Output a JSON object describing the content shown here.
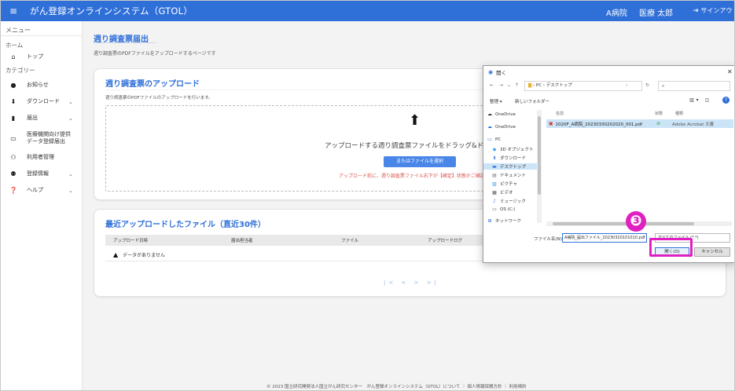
{
  "header": {
    "menu_icon": "hamburger-icon",
    "title": "がん登録オンラインシステム（GTOL）",
    "hospital": "A病院",
    "user": "医療 太郎",
    "signout_icon": "signout-icon",
    "signout_label": "サインアウト"
  },
  "sidebar": {
    "menu_heading": "メニュー",
    "home_heading": "ホーム",
    "category_heading": "カテゴリー",
    "items": [
      {
        "label": "トップ",
        "icon": "home-icon",
        "glyph": "🏠"
      },
      {
        "label": "お知らせ",
        "icon": "info-icon",
        "glyph": "ℹ"
      },
      {
        "label": "ダウンロード",
        "icon": "download-icon",
        "glyph": "⬇"
      },
      {
        "label": "届出",
        "icon": "document-icon",
        "glyph": "▮"
      },
      {
        "label": "医療機関向け提供データ登録届出",
        "icon": "monitor-icon",
        "glyph": "▭"
      },
      {
        "label": "利用者管理",
        "icon": "users-icon",
        "glyph": "👥"
      },
      {
        "label": "登録情報",
        "icon": "user-settings-icon",
        "glyph": "👤"
      },
      {
        "label": "ヘルプ",
        "icon": "help-icon",
        "glyph": "?"
      }
    ]
  },
  "main": {
    "title": "週り調査票届出",
    "description": "週り調査票のPDFファイルをアップロードするページです",
    "upload_card": {
      "title": "週り調査票のアップロード",
      "description": "週り調査票のPDFファイルのアップロードを行います。",
      "drop_text": "アップロードする週り調査票ファイルをドラッグ&ドロップし",
      "select_button": "またはファイルを選択",
      "warning": "アップロード前に、週り調査票ファイル右下が【確定】状態かご確認くだ"
    },
    "recent_card": {
      "title": "最近アップロードしたファイル（直近30件）",
      "columns": [
        "アップロード日時",
        "届出担当者",
        "ファイル",
        "アップロードログ"
      ],
      "empty_text": "データがありません",
      "pager": "|< < > >|"
    },
    "footer": "© 2023 国立研究開発法人国立がん研究センター　がん登録オンラインシステム（GTOL）について ｜ 個人情報保護方針 ｜ 利用規約"
  },
  "dialog": {
    "title": "開く",
    "path": "› PC › デスクトップ",
    "search_placeholder": "",
    "toolbar": {
      "organize": "整理 ▾",
      "new_folder": "新しいフォルダー"
    },
    "nav_items": [
      {
        "label": "OneDrive",
        "icon": "onedrive-icon",
        "glyph": "☁"
      },
      {
        "label": "OneDrive",
        "icon": "onedrive-icon",
        "glyph": "☁"
      },
      {
        "label": "PC",
        "icon": "pc-icon",
        "glyph": "🖥"
      },
      {
        "label": "3D オブジェクト",
        "icon": "3d-objects-icon",
        "glyph": "◆"
      },
      {
        "label": "ダウンロード",
        "icon": "download-icon",
        "glyph": "⬇"
      },
      {
        "label": "デスクトップ",
        "icon": "desktop-icon",
        "glyph": "▬"
      },
      {
        "label": "ドキュメント",
        "icon": "documents-icon",
        "glyph": "▤"
      },
      {
        "label": "ピクチャ",
        "icon": "pictures-icon",
        "glyph": "▧"
      },
      {
        "label": "ビデオ",
        "icon": "video-icon",
        "glyph": "▦"
      },
      {
        "label": "ミュージック",
        "icon": "music-icon",
        "glyph": "♪"
      },
      {
        "label": "OS (C:)",
        "icon": "drive-icon",
        "glyph": "▭"
      },
      {
        "label": "ネットワーク",
        "icon": "network-icon",
        "glyph": "⊞"
      }
    ],
    "columns": {
      "name": "名前",
      "status": "状態",
      "type": "種類"
    },
    "file": {
      "name": "2020F_A病院_20230330202020_001.pdf",
      "type": "Adobe Acrobat 文書"
    },
    "filename_label": "ファイル名(N):",
    "filename_value": "A病院_届出ファイル_20230320101010.pdf",
    "filetype": "すべてのファイル (*.*)",
    "open_button": "開く(O)",
    "cancel_button": "キャンセル"
  },
  "annotation": {
    "step_number": "❸",
    "color": "#e020c0"
  }
}
